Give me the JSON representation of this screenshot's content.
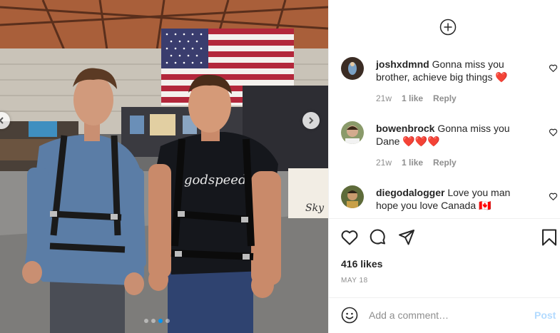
{
  "media": {
    "shirt_text": "godspeed",
    "banner_text": "Sky",
    "carousel": {
      "count": 4,
      "active_index": 2
    },
    "icons": {
      "prev": "chevron-left-icon",
      "next": "chevron-right-icon"
    }
  },
  "header": {
    "add_icon": "plus-circle-icon"
  },
  "comments": [
    {
      "username": "joshxdmnd",
      "text": "Gonna miss you brother, achieve big things ❤️",
      "age": "21w",
      "likes": "1 like",
      "reply": "Reply"
    },
    {
      "username": "bowenbrock",
      "text": "Gonna miss you Dane ❤️❤️❤️",
      "age": "21w",
      "likes": "1 like",
      "reply": "Reply"
    },
    {
      "username": "diegodalogger",
      "text": "Love you man hope you love Canada 🇨🇦"
    }
  ],
  "actions": {
    "icons": [
      "heart-icon",
      "comment-icon",
      "share-icon",
      "bookmark-icon"
    ]
  },
  "likes": "416 likes",
  "date": "MAY 18",
  "add_comment": {
    "placeholder": "Add a comment…",
    "post_label": "Post"
  },
  "colors": {
    "accent": "#0095f6",
    "post_disabled": "#b3dbff",
    "secondary_text": "#8e8e8e",
    "heart_red": "#ed4956"
  }
}
